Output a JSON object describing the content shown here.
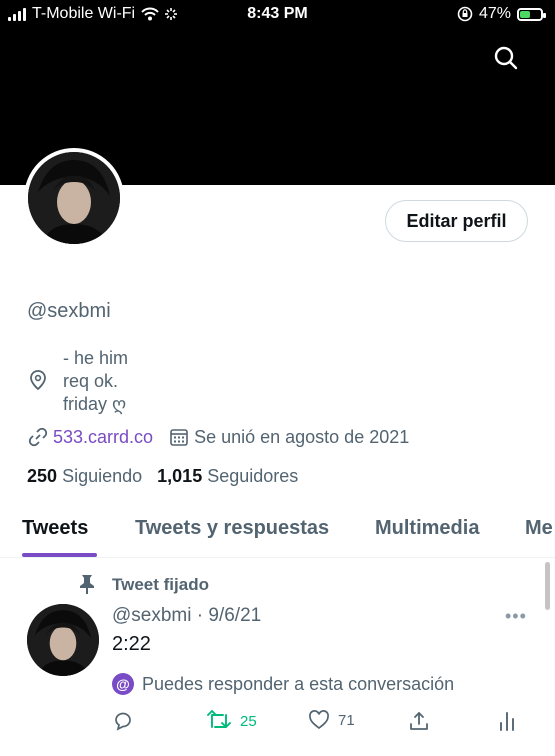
{
  "status_bar": {
    "carrier": "T-Mobile Wi-Fi",
    "time": "8:43 PM",
    "battery": "47%",
    "battery_level": 0.47
  },
  "header": {
    "search_icon": "search-icon",
    "background_color": "#000000"
  },
  "profile": {
    "edit_button": "Editar perfil",
    "handle": "@sexbmi",
    "bio_lines": [
      "- he him",
      "req ok.",
      "friday ღ"
    ],
    "bio_icon": "location-pin-icon",
    "link_icon": "link-icon",
    "link": "533.carrd.co",
    "calendar_icon": "calendar-icon",
    "joined": "Se unió en agosto de 2021",
    "following_count": "250",
    "following_label": "Siguiendo",
    "followers_count": "1,015",
    "followers_label": "Seguidores",
    "accent_color": "#794bc4"
  },
  "tabs": [
    "Tweets",
    "Tweets y respuestas",
    "Multimedia",
    "Me gusta"
  ],
  "tweet": {
    "pinned_label": "Tweet fijado",
    "handle": "@sexbmi",
    "separator": " · ",
    "date": "9/6/21",
    "more": "•••",
    "text": "2:22",
    "reply_badge": "@",
    "reply_note": "Puedes responder a esta conversación",
    "actions": {
      "reply": "",
      "retweets": "25",
      "likes": "71",
      "share": "",
      "analytics": ""
    },
    "retweet_color": "#00ba7c"
  }
}
